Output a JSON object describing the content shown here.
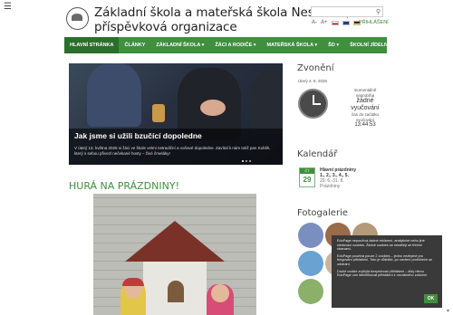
{
  "header": {
    "menu_icon": "hamburger-icon",
    "logo_icon": "school-logo-icon",
    "title_line1": "Základní škola a mateřská škola Nesovice,",
    "title_line2": "příspěvková organizace",
    "search_icon": "search-icon",
    "font_small": "A-",
    "font_large": "A+",
    "login_label": "PŘIHLÁŠENÍ"
  },
  "nav": {
    "items": [
      {
        "label": "HLAVNÍ STRÁNKA"
      },
      {
        "label": "ČLÁNKY"
      },
      {
        "label": "ZÁKLADNÍ ŠKOLA ▾"
      },
      {
        "label": "ŽÁCI A RODIČE ▾"
      },
      {
        "label": "MATEŘSKÁ ŠKOLA ▾"
      },
      {
        "label": "ŠD ▾"
      },
      {
        "label": "ŠKOLNÍ JÍDELNA ▾"
      }
    ]
  },
  "slider": {
    "title": "Jak jsme si užili bzučící dopoledne",
    "text": "V úterý 13. května 2026 si žáci ve škole velmi netradiční a voňavé dopoledne. Zavítal k nám totiž pan Koblih, který s sebou přivezl nečekané hosty – živé čmeláky!"
  },
  "main": {
    "article_heading": "HURÁ NA PRÁZDNINY!"
  },
  "sidebar": {
    "clock_heading": "Zvonění",
    "clock_date": "Úterý 4. 8. 2026",
    "clock_state_line1": "momentálně",
    "clock_state_line2": "neprobíhá",
    "clock_state_big1": "žádné",
    "clock_state_big2": "vyučování",
    "clock_until_line1": "čas do začátku",
    "clock_until_line2": "vyučování",
    "clock_time": "13:44:53",
    "calendar_heading": "Kalendář",
    "calendar_day": "ČT",
    "calendar_num": "29",
    "calendar_event_title": "Hlavní prázdniny",
    "calendar_event_line2": "1., 2., 3., 4., 5.",
    "calendar_event_line3": "29. 6.-31. 8.",
    "calendar_event_line4": "Prázdniny",
    "gallery_heading": "Fotogalerie"
  },
  "cookie": {
    "text1": "EduPage nepoužívá žádné reklamní, analytické nebo jiné sledovací cookies. Žádné cookies se nesdílejí se třetími stranami.",
    "text2": "EduPage používá pouze 2 cookies – jedno nezbytné pro fungování přihlášení. Toto je důležité, po zavření prohlížeče se odstraní.",
    "text3": "Druhé cookie zvýhýlá bezpečnost přihlášení – díky němu EduPage umí identifikovat přihlášení z nezrámého zařízení.",
    "ok_label": "OK"
  }
}
